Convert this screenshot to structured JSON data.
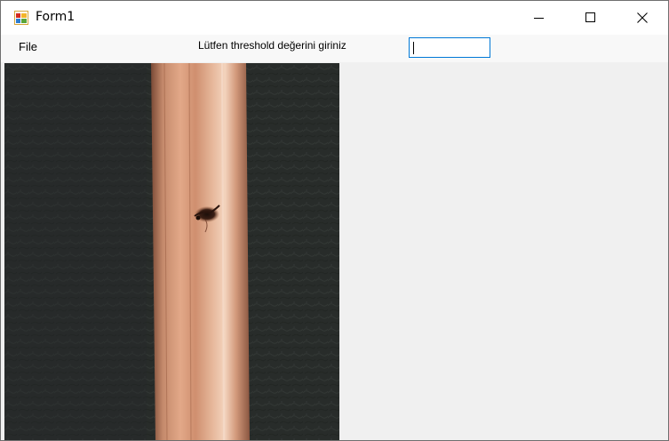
{
  "window": {
    "title": "Form1"
  },
  "menu": {
    "file_label": "File"
  },
  "threshold": {
    "prompt": "Lütfen threshold değerini giriniz",
    "value": ""
  },
  "picture": {
    "subject": "copper-pipe-with-defect-photo"
  },
  "colors": {
    "input_border": "#0078d7",
    "window_bg": "#f0f0f0",
    "menubar_bg": "#f8f8f8"
  }
}
